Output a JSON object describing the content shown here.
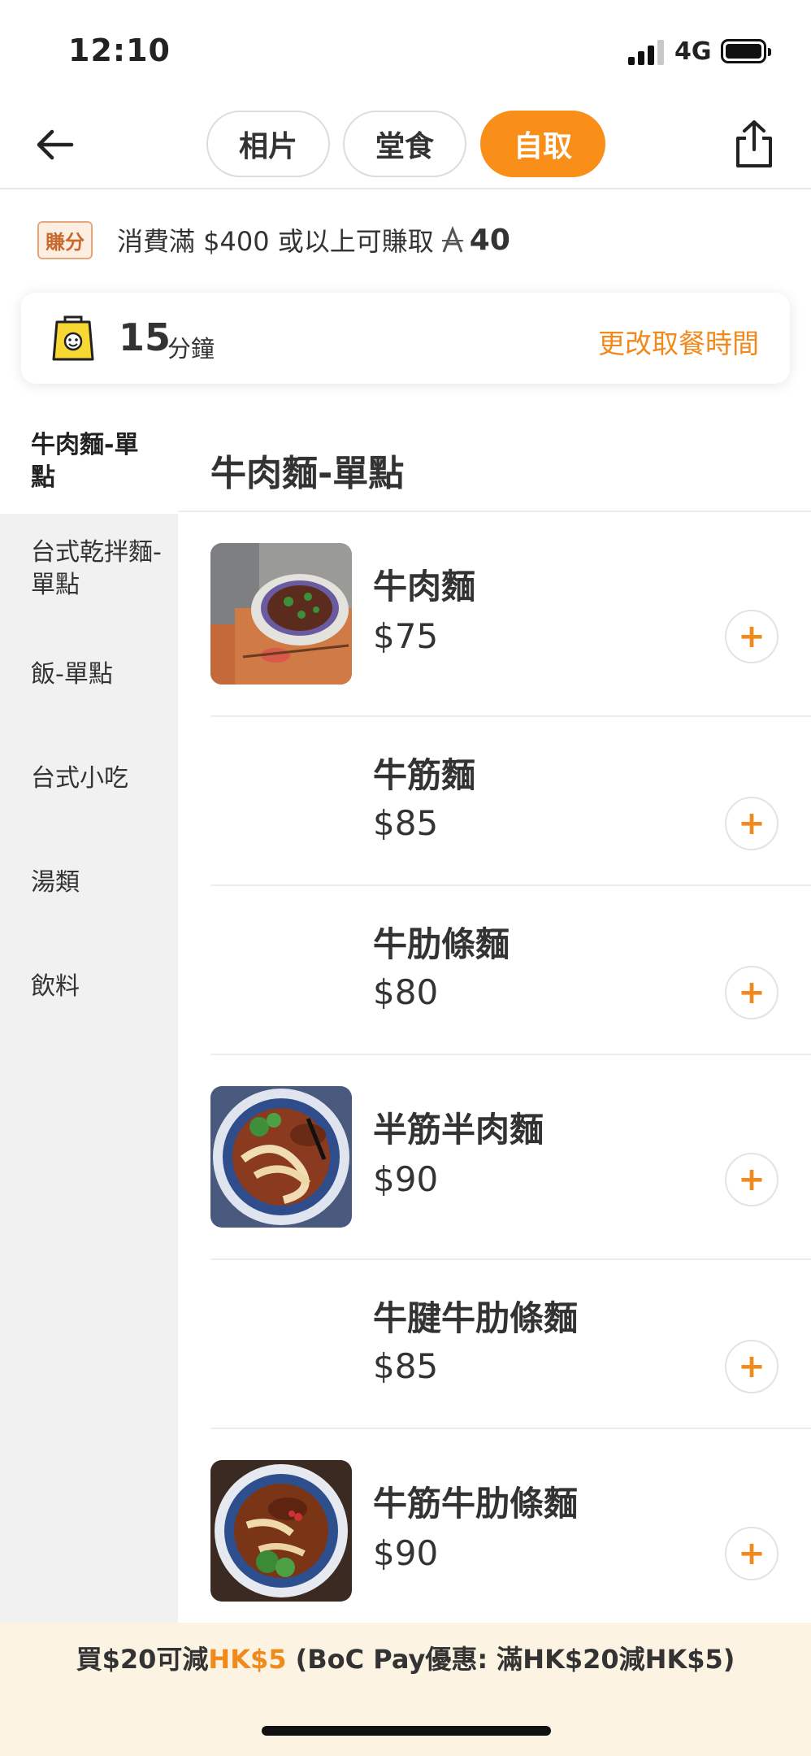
{
  "status_bar": {
    "time": "12:10",
    "network": "4G"
  },
  "nav": {
    "tabs": [
      {
        "label": "相片",
        "active": false
      },
      {
        "label": "堂食",
        "active": false
      },
      {
        "label": "自取",
        "active": true
      }
    ],
    "accent_color": "#f98e19"
  },
  "points": {
    "badge": "賺分",
    "text": "消費滿 $400 或以上可賺取",
    "symbol": "A",
    "value": "40"
  },
  "pickup": {
    "minutes": "15",
    "unit": "分鐘",
    "change_label": "更改取餐時間"
  },
  "sidebar": {
    "items": [
      {
        "label": "牛肉麵-單點",
        "active": true
      },
      {
        "label": "台式乾拌麵-單點",
        "active": false
      },
      {
        "label": "飯-單點",
        "active": false
      },
      {
        "label": "台式小吃",
        "active": false
      },
      {
        "label": "湯類",
        "active": false
      },
      {
        "label": "飲料",
        "active": false
      }
    ]
  },
  "menu": {
    "section_title": "牛肉麵-單點",
    "items": [
      {
        "name": "牛肉麵",
        "price": "$75",
        "has_image": true
      },
      {
        "name": "牛筋麵",
        "price": "$85",
        "has_image": false
      },
      {
        "name": "牛肋條麵",
        "price": "$80",
        "has_image": false
      },
      {
        "name": "半筋半肉麵",
        "price": "$90",
        "has_image": true
      },
      {
        "name": "牛腱牛肋條麵",
        "price": "$85",
        "has_image": false
      },
      {
        "name": "牛筋牛肋條麵",
        "price": "$90",
        "has_image": true
      }
    ],
    "add_symbol": "+"
  },
  "promo": {
    "prefix": "買$20可減",
    "highlight": "HK$5",
    "suffix": " (BoC Pay優惠: 滿HK$20減HK$5)"
  }
}
